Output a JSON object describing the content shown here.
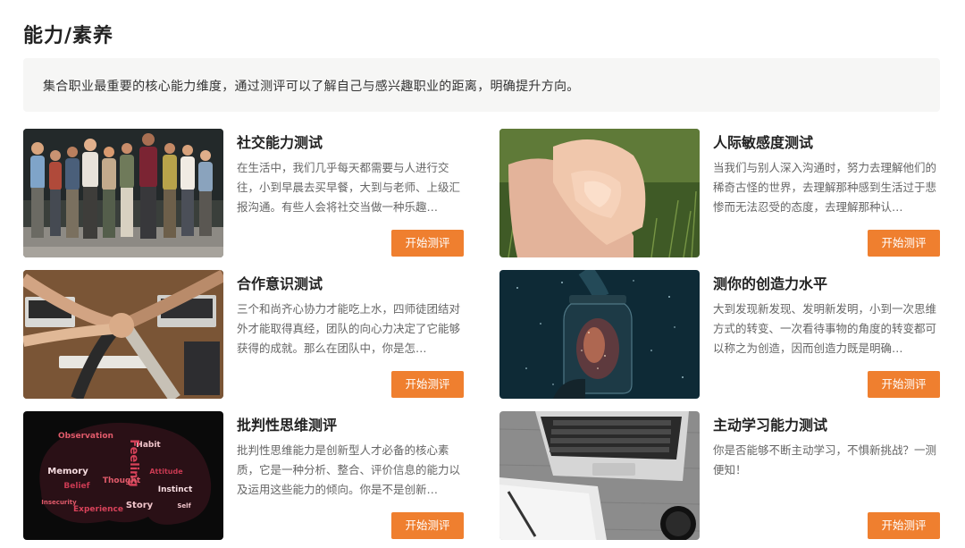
{
  "section": {
    "title": "能力/素养",
    "intro": "集合职业最重要的核心能力维度，通过测评可以了解自己与感兴趣职业的距离，明确提升方向。"
  },
  "cards": [
    {
      "title": "社交能力测试",
      "desc": "在生活中，我们几乎每天都需要与人进行交往，小到早晨去买早餐，大到与老师、上级汇报沟通。有些人会将社交当做一种乐趣…",
      "button": "开始测评",
      "image": "group-of-people-photo"
    },
    {
      "title": "人际敏感度测试",
      "desc": "当我们与别人深入沟通时，努力去理解他们的稀奇古怪的世界，去理解那种感到生活过于悲惨而无法忍受的态度，去理解那种认…",
      "button": "开始测评",
      "image": "hands-together-photo"
    },
    {
      "title": "合作意识测试",
      "desc": "三个和尚齐心协力才能吃上水，四师徒团结对外才能取得真经，团队的向心力决定了它能够获得的成就。那么在团队中，你是怎…",
      "button": "开始测评",
      "image": "team-fist-bump-photo"
    },
    {
      "title": "测你的创造力水平",
      "desc": "大到发现新发现、发明新发明，小到一次思维方式的转变、一次看待事物的角度的转变都可以称之为创造，因而创造力既是明确…",
      "button": "开始测评",
      "image": "galaxy-jar-photo"
    },
    {
      "title": "批判性思维测评",
      "desc": "批判性思维能力是创新型人才必备的核心素质，它是一种分析、整合、评价信息的能力以及运用这些能力的倾向。你是不是创新…",
      "button": "开始测评",
      "image": "brain-word-cloud-image",
      "brain_words": [
        "Observation",
        "Habit",
        "Feeling",
        "Memory",
        "Belief",
        "Thought",
        "Story",
        "Experience",
        "Instinct",
        "Attitude",
        "Insecurity",
        "Self"
      ]
    },
    {
      "title": "主动学习能力测试",
      "desc": "你是否能够不断主动学习，不惧新挑战？一测便知！",
      "button": "开始测评",
      "image": "laptop-notebook-photo"
    }
  ],
  "colors": {
    "accent": "#ef7f2f",
    "intro_bg": "#f6f6f5",
    "title": "#222222",
    "desc": "#666666"
  }
}
